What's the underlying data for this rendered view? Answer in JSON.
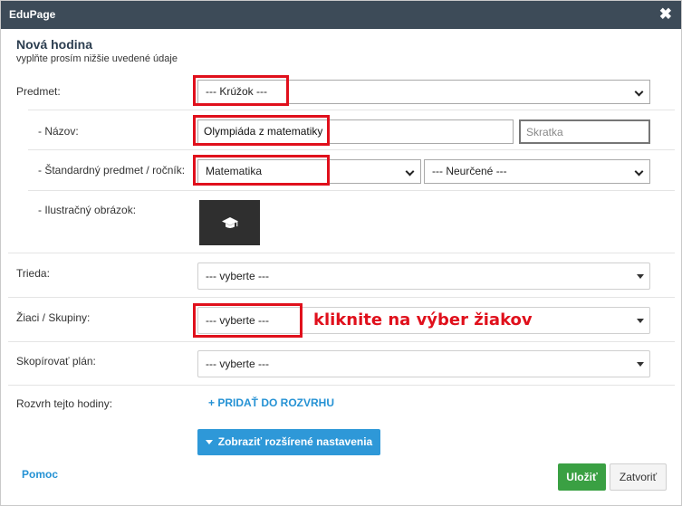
{
  "window": {
    "app_title": "EduPage",
    "close_glyph": "✖"
  },
  "header": {
    "title": "Nová hodina",
    "subtitle": "vyplňte prosím nižšie uvedené údaje"
  },
  "form": {
    "predmet": {
      "label": "Predmet:",
      "value": "--- Krúžok ---"
    },
    "nazov": {
      "label": "- Názov:",
      "value": "Olympiáda z matematiky",
      "short_placeholder": "Skratka"
    },
    "standard": {
      "label": "- Štandardný predmet / ročník:",
      "subject": "Matematika",
      "grade": "--- Neurčené ---"
    },
    "obrazok": {
      "label": "- Ilustračný obrázok:",
      "icon": "graduation-cap-icon"
    },
    "trieda": {
      "label": "Trieda:",
      "value": "--- vyberte ---"
    },
    "ziaci": {
      "label": "Žiaci / Skupiny:",
      "value": "--- vyberte ---"
    },
    "plan": {
      "label": "Skopírovať plán:",
      "value": "--- vyberte ---"
    },
    "rozvrh": {
      "label": "Rozvrh tejto hodiny:",
      "add_link": "+ PRIDAŤ DO ROZVRHU"
    }
  },
  "annotation": {
    "text": "kliknite na výber žiakov",
    "color": "#e0101c"
  },
  "actions": {
    "advanced": "Zobraziť rozšírené nastavenia",
    "help": "Pomoc",
    "save": "Uložiť",
    "close": "Zatvoriť"
  },
  "colors": {
    "titlebar": "#3d4b58",
    "accent_blue": "#2e98d8",
    "save_green": "#3aa043",
    "highlight_red": "#e0101c"
  }
}
